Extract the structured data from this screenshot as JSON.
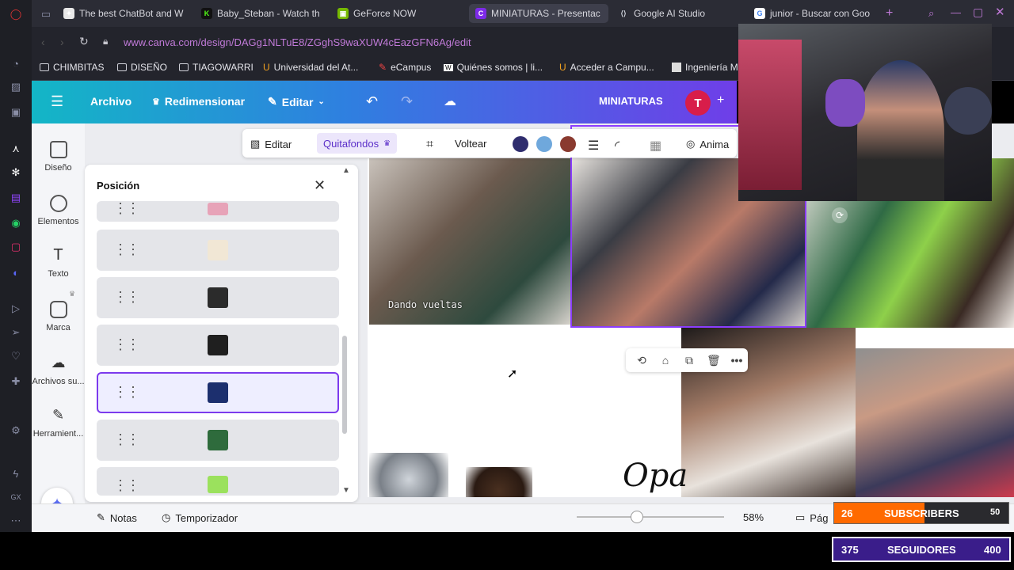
{
  "browser": {
    "tabs": [
      {
        "label": "The best ChatBot and W",
        "icon": "openai-icon",
        "color": "#e8e8e8"
      },
      {
        "label": "Baby_Steban - Watch th",
        "icon": "kick-icon",
        "color": "#53fc18"
      },
      {
        "label": "GeForce NOW",
        "icon": "nvidia-icon",
        "color": "#76b900"
      },
      {
        "label": "MINIATURAS - Presentac",
        "icon": "canva-icon",
        "color": "#7d2ae8"
      },
      {
        "label": "Google AI Studio",
        "icon": "google-ai-icon",
        "color": "#4285f4"
      },
      {
        "label": "junior - Buscar con Goo",
        "icon": "google-icon",
        "color": "#ea4335"
      }
    ],
    "url": "www.canva.com/design/DAGg1NLTuE8/ZGghS9waXUW4cEazGFN6Ag/edit",
    "bookmarks": [
      "CHIMBITAS",
      "DISEÑO",
      "TIAGOWARRI",
      "Universidad del At...",
      "eCampus",
      "Quiénes somos | li...",
      "Acceder a Campu...",
      "Ingeniería M"
    ]
  },
  "canva": {
    "header": {
      "menu_icon": "hamburger-icon",
      "archivo": "Archivo",
      "redimensionar": "Redimensionar",
      "editar": "Editar",
      "title": "MINIATURAS",
      "avatar_letter": "T"
    },
    "sidebar": [
      {
        "label": "Diseño",
        "icon": "layout-icon"
      },
      {
        "label": "Elementos",
        "icon": "shapes-icon"
      },
      {
        "label": "Texto",
        "icon": "text-icon"
      },
      {
        "label": "Marca",
        "icon": "brand-icon"
      },
      {
        "label": "Archivos su...",
        "icon": "cloud-upload-icon"
      },
      {
        "label": "Herramient...",
        "icon": "tools-icon"
      }
    ],
    "panel": {
      "title": "Posición",
      "layers": [
        {
          "thumb_color": "#e7a3b8"
        },
        {
          "thumb_color": "#f1e7d5"
        },
        {
          "thumb_color": "#2b2b2b"
        },
        {
          "thumb_color": "#1f1f1f"
        },
        {
          "thumb_color": "#1c2f6e"
        },
        {
          "thumb_color": "#2e6b3c"
        },
        {
          "thumb_color": "#9be15d"
        }
      ]
    },
    "toolbar": {
      "editar": "Editar",
      "quitafondos": "Quitafondos",
      "voltear": "Voltear",
      "animar": "Anima",
      "swatches": [
        "#2f2d6e",
        "#6fa8dc",
        "#8a3a2f"
      ]
    },
    "canvas_text": {
      "dando_vueltas": "Dando vueltas",
      "opa": "Opa"
    },
    "footer": {
      "notas": "Notas",
      "temporizador": "Temporizador",
      "zoom_percent": "58%",
      "zoom_value": 0.58,
      "pag": "Pág"
    }
  },
  "overlay": {
    "subscribers": {
      "current": "26",
      "label": "SUBSCRIBERS",
      "goal": "50",
      "progress": 0.52,
      "color": "#ff6a00"
    },
    "seguidores": {
      "current": "375",
      "label": "SEGUIDORES",
      "goal": "400",
      "progress": 0.9375,
      "color": "#3a1d8a"
    }
  }
}
